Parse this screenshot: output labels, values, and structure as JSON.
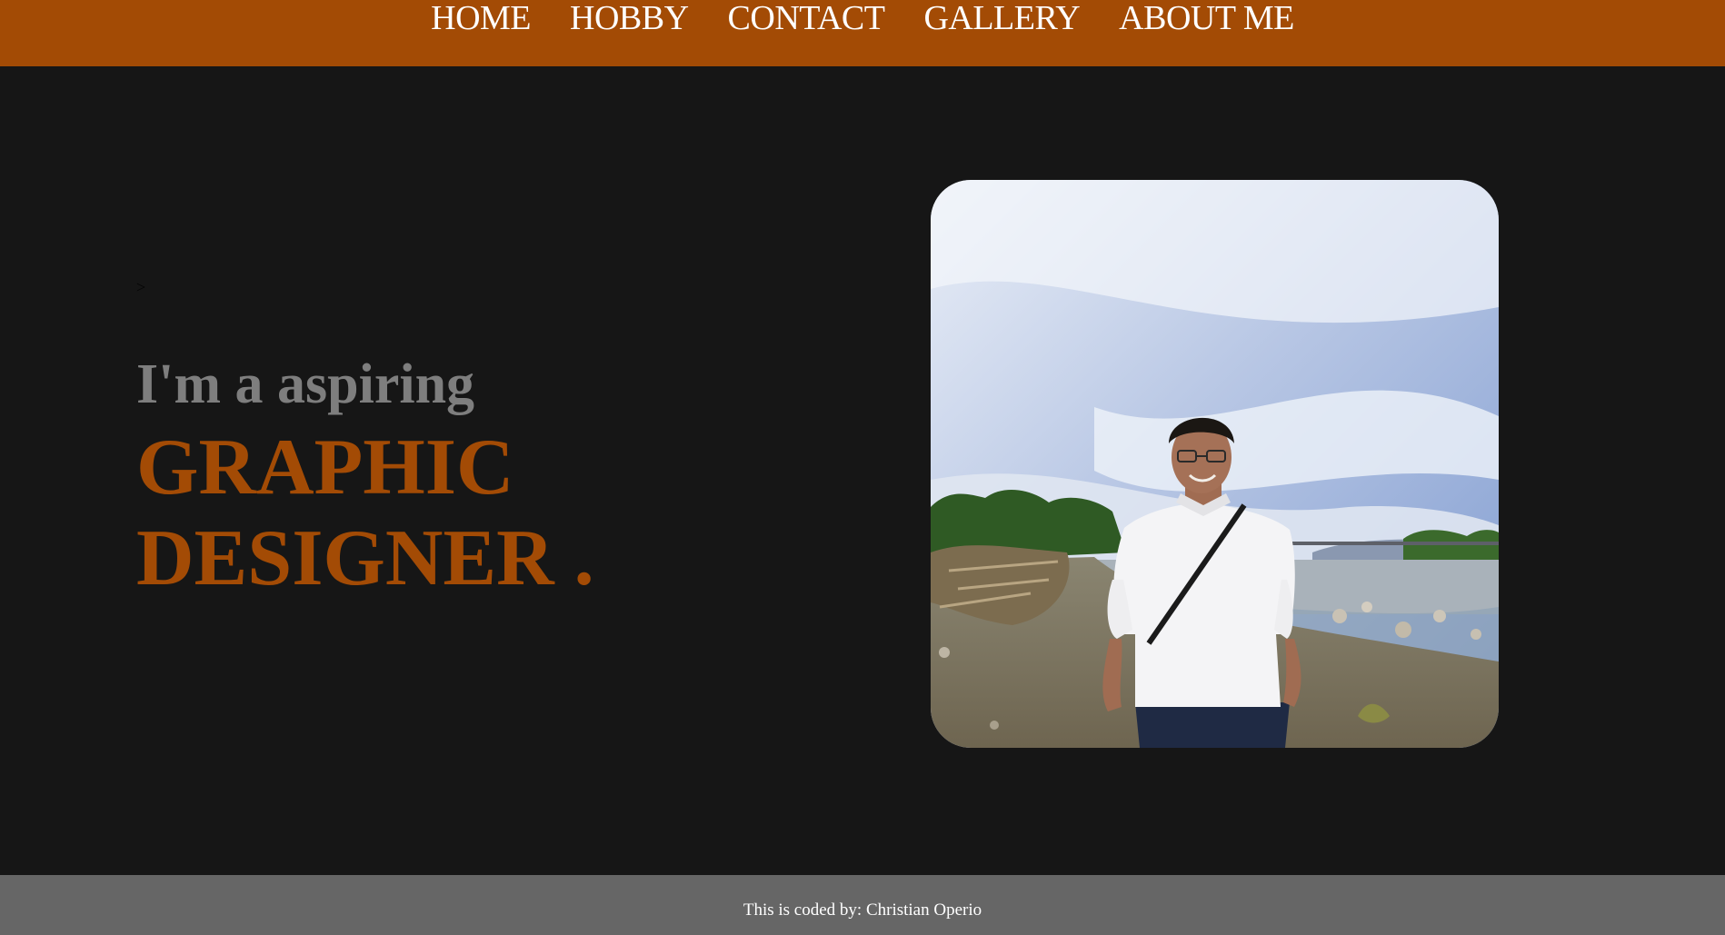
{
  "nav": {
    "items": [
      {
        "label": "HOME"
      },
      {
        "label": "HOBBY"
      },
      {
        "label": "CONTACT"
      },
      {
        "label": "GALLERY"
      },
      {
        "label": "ABOUT ME"
      }
    ]
  },
  "hero": {
    "stray_text": ">",
    "subtitle": "I'm a aspiring",
    "title_line1": "GRAPHIC",
    "title_line2": "DESIGNER ."
  },
  "footer": {
    "text": "This is coded by: Christian Operio"
  },
  "colors": {
    "accent": "#a34b05",
    "background": "#161616",
    "footer": "#666666",
    "subtitle": "#7e7e7e"
  }
}
